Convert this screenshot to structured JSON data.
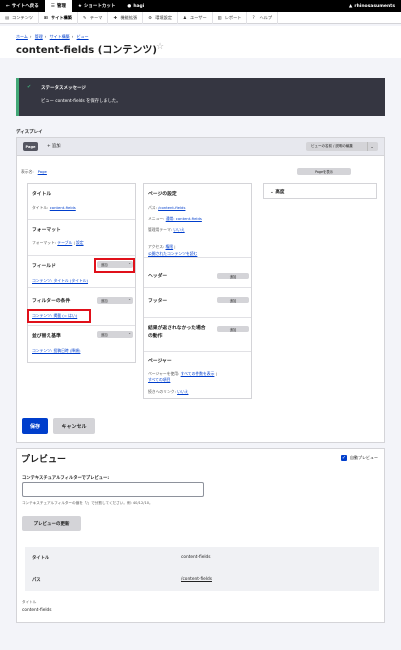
{
  "toolbar": {
    "back_label": "サイトへ戻る",
    "manage_label": "管理",
    "shortcuts_label": "ショートカット",
    "user_label": "hagi",
    "site_label": "rhinosasuments"
  },
  "tray": {
    "items": [
      {
        "label": "コンテンツ",
        "icon": "content-icon"
      },
      {
        "label": "サイト構築",
        "icon": "structure-icon"
      },
      {
        "label": "テーマ",
        "icon": "appearance-icon"
      },
      {
        "label": "機能拡張",
        "icon": "extend-icon"
      },
      {
        "label": "環境設定",
        "icon": "config-icon"
      },
      {
        "label": "ユーザー",
        "icon": "people-icon"
      },
      {
        "label": "レポート",
        "icon": "reports-icon"
      },
      {
        "label": "ヘルプ",
        "icon": "help-icon"
      }
    ]
  },
  "breadcrumb": [
    "ホーム",
    "管理",
    "サイト構築",
    "ビュー"
  ],
  "page_title": "content-fields (コンテンツ)",
  "status": {
    "title": "ステータスメッセージ",
    "message": "ビュー content-fields を保存しました。"
  },
  "display": {
    "section_label": "ディスプレイ",
    "page_tab": "Page",
    "add_tab": "+ 追加",
    "edit_name_button": "ビューの名前 / 説明の編集",
    "display_name_label": "表示名:",
    "display_name_value": "Page",
    "show_page_button": "Pageを表示"
  },
  "left": {
    "title_heading": "タイトル",
    "title_label": "タイトル:",
    "title_value": "content-fields",
    "format_heading": "フォーマット",
    "format_label": "フォーマット:",
    "format_value": "テーブル",
    "format_settings": "設定",
    "fields_heading": "フィールド",
    "fields_add": "追加",
    "fields_value": "コンテンツ: タイトル (タイトル)",
    "filter_heading": "フィルターの条件",
    "filter_add": "追加",
    "filter_value": "コンテンツ: 掲載 (= はい)",
    "sort_heading": "並び替え基準",
    "sort_add": "追加",
    "sort_value": "コンテンツ: 投稿日時 (降順)"
  },
  "mid": {
    "page_settings_heading": "ページの設定",
    "path_label": "パス:",
    "path_value": "/content-fields",
    "menu_label": "メニュー:",
    "menu_value": "通常: content-fields",
    "theme_label": "管理用テーマ:",
    "theme_value": "いいえ",
    "access_label": "アクセス:",
    "access_value": "権限",
    "access_value2": "公開されたコンテンツを読む",
    "header_heading": "ヘッダー",
    "header_add": "追加",
    "footer_heading": "フッター",
    "footer_add": "追加",
    "empty_heading_1": "結果が返されなかった場合",
    "empty_heading_2": "の動作",
    "empty_add": "追加",
    "pager_heading": "ページャー",
    "pager_label": "ページャーを使用:",
    "pager_value": "すべての件数を表示",
    "pager_value2": "すべての項目",
    "more_label": "続きへのリンク:",
    "more_value": "いいえ"
  },
  "right": {
    "advanced": "高度"
  },
  "actions": {
    "save": "保存",
    "cancel": "キャンセル"
  },
  "preview": {
    "title": "プレビュー",
    "auto_preview": "自動プレビュー",
    "ctx_label": "コンテキスチュアルフィルターでプレビュー:",
    "ctx_help": "コンテキスチュアルフィルターの値を「/」で分割してください。例: 40/12/10。",
    "update_button": "プレビューの更新",
    "rows": [
      {
        "key": "タイトル",
        "value": "content-fields",
        "link": false
      },
      {
        "key": "パス",
        "value": "/content-fields",
        "link": true
      }
    ],
    "field_label": "タイトル",
    "field_value": "content-fields"
  },
  "colors": {
    "accent": "#003ecc",
    "status_bg": "#353641",
    "status_ok": "#42a877",
    "highlight": "#e0101a"
  }
}
